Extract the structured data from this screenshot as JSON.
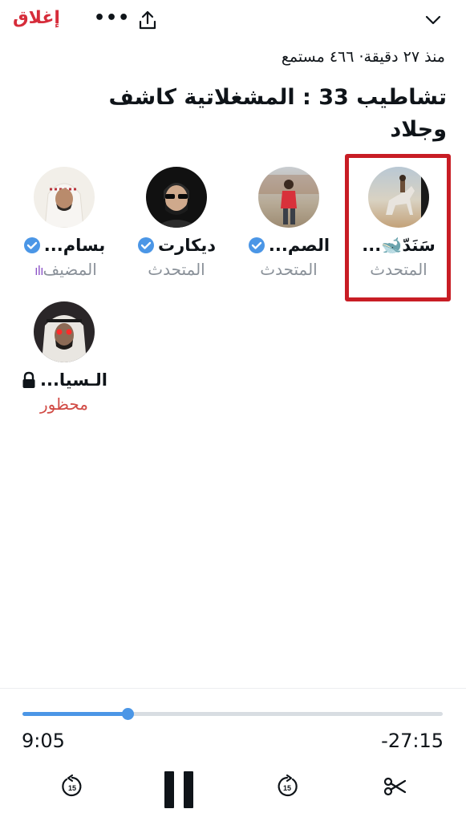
{
  "header": {
    "close_label": "إغلاق",
    "more_label": "•••",
    "share_icon": "share-icon",
    "collapse_icon": "chevron-down-icon"
  },
  "space": {
    "meta": "منذ ٢٧ دقيقة· ٤٦٦ مستمع",
    "title": "تشاطيب 33 : المشغلاتية كاشف وجلاد"
  },
  "participants": [
    {
      "name": "سَنَدّ🐋...",
      "role": "المتحدث",
      "verified": false,
      "highlighted": true
    },
    {
      "name": "الصم...",
      "role": "المتحدث",
      "verified": true
    },
    {
      "name": "ديكارت",
      "role": "المتحدث",
      "verified": true
    },
    {
      "name": "بسام...",
      "role": "المضيف",
      "verified": true
    },
    {
      "name": "الـسيا...",
      "role": "محظور",
      "locked": true
    }
  ],
  "player": {
    "elapsed": "9:05",
    "remaining": "-27:15",
    "progress": 0.25,
    "rewind_label": "15",
    "forward_label": "15"
  },
  "colors": {
    "accent": "#4b96e6",
    "close": "#d62c3a",
    "banned": "#d14b45",
    "highlight": "#c81d25",
    "host_dots": "#8e56c8"
  }
}
